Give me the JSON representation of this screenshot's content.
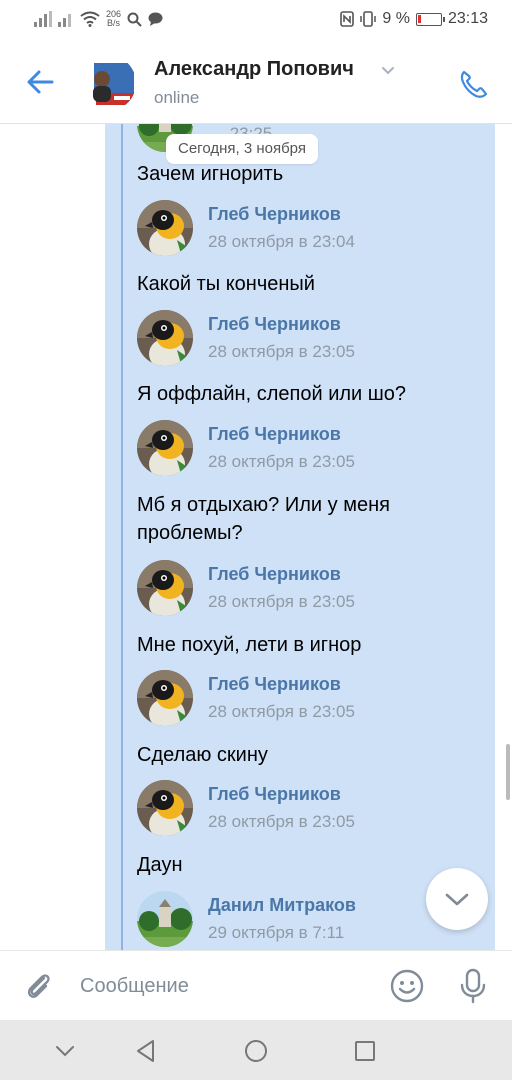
{
  "status_bar": {
    "net_speed_value": "206",
    "net_speed_unit": "B/s",
    "battery_percent": "9 %",
    "time": "23:13"
  },
  "header": {
    "contact_name": "Александр Попович",
    "contact_status": "online"
  },
  "chat": {
    "partial_time": "… 23:25",
    "date_divider": "Сегодня, 3 ноября",
    "messages": [
      {
        "text": "Зачем игнорить",
        "author": "Глеб Черников",
        "time": "28 октября в 23:04"
      },
      {
        "text": "Какой ты конченый",
        "author": "Глеб Черников",
        "time": "28 октября в 23:05"
      },
      {
        "text": "Я оффлайн, слепой или шо?",
        "author": "Глеб Черников",
        "time": "28 октября в 23:05"
      },
      {
        "text": "Мб я отдыхаю? Или у меня проблемы?",
        "author": "Глеб Черников",
        "time": "28 октября в 23:05"
      },
      {
        "text": "Мне похуй, лети в игнор",
        "author": "Глеб Черников",
        "time": "28 октября в 23:05"
      },
      {
        "text": "Сделаю скину",
        "author": "Глеб Черников",
        "time": "28 октября в 23:05"
      },
      {
        "text": "Даун",
        "author": "Данил Митраков",
        "time": "29 октября в 7:11"
      }
    ]
  },
  "composer": {
    "placeholder": "Сообщение"
  },
  "icons": {
    "back": "arrow-left-icon",
    "call": "phone-icon",
    "attach": "paperclip-icon",
    "emoji": "smiley-icon",
    "mic": "microphone-icon",
    "scroll": "chevron-down-icon"
  },
  "colors": {
    "accent": "#3f8ae0",
    "author_name": "#4a76a8",
    "forward_background": "#cfe1f7",
    "forward_line": "#8fb4e3"
  }
}
